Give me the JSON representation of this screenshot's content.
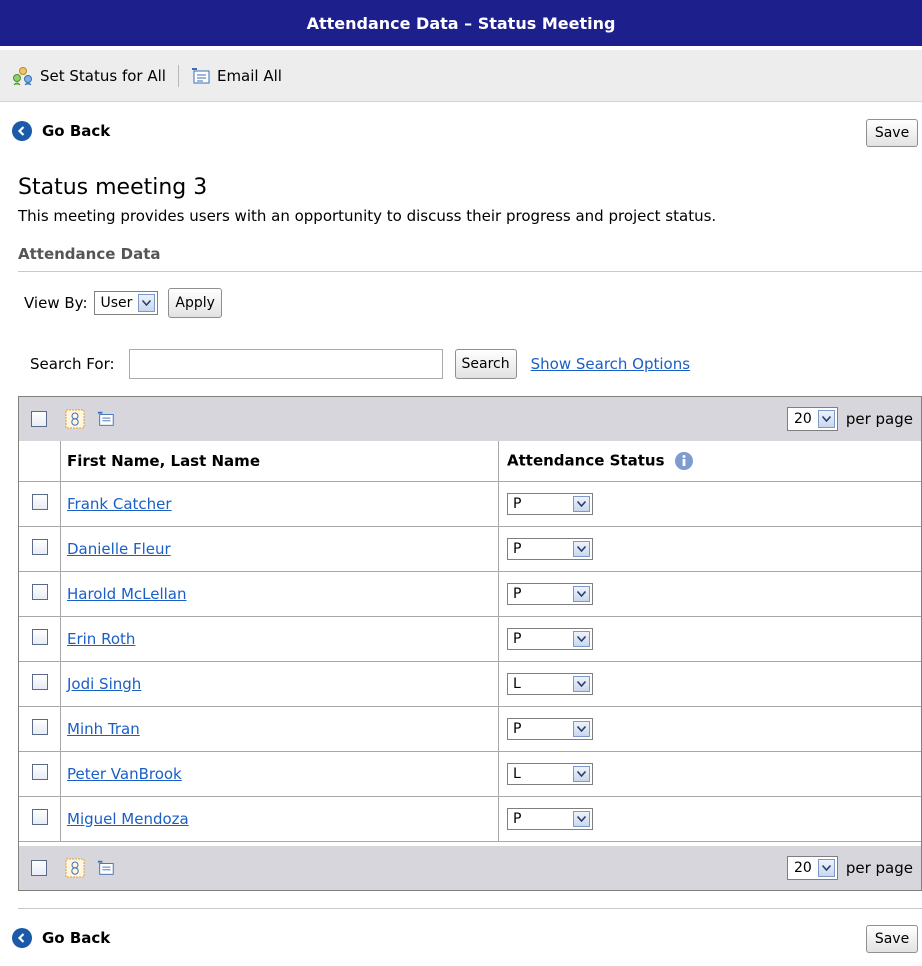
{
  "header": {
    "title": "Attendance Data – Status Meeting"
  },
  "toolbar": {
    "set_status_all": "Set Status for All",
    "email_all": "Email All"
  },
  "nav": {
    "go_back": "Go Back",
    "save": "Save"
  },
  "meeting": {
    "title": "Status meeting 3",
    "description": "This meeting provides users with an opportunity to discuss their progress and project status."
  },
  "section": {
    "heading": "Attendance Data"
  },
  "view_by": {
    "label": "View By:",
    "value": "User",
    "apply": "Apply"
  },
  "search": {
    "label": "Search For:",
    "value": "",
    "button": "Search",
    "options_link": "Show Search Options"
  },
  "grid": {
    "per_page_value": "20",
    "per_page_label": "per page",
    "columns": {
      "name": "First Name, Last Name",
      "status": "Attendance Status"
    },
    "rows": [
      {
        "name": "Frank Catcher",
        "status": "P"
      },
      {
        "name": "Danielle Fleur",
        "status": "P"
      },
      {
        "name": "Harold McLellan",
        "status": "P"
      },
      {
        "name": "Erin Roth",
        "status": "P"
      },
      {
        "name": "Jodi Singh",
        "status": "L"
      },
      {
        "name": "Minh Tran",
        "status": "P"
      },
      {
        "name": "Peter VanBrook",
        "status": "L"
      },
      {
        "name": "Miguel Mendoza",
        "status": "P"
      }
    ]
  },
  "colors": {
    "title_bar": "#1d1f8c",
    "link": "#1a5fc6",
    "grid_bar": "#d6d6dc"
  },
  "icons": {
    "set_status": "users-group-icon",
    "email": "email-list-icon",
    "back": "back-arrow-icon",
    "info": "info-icon"
  }
}
